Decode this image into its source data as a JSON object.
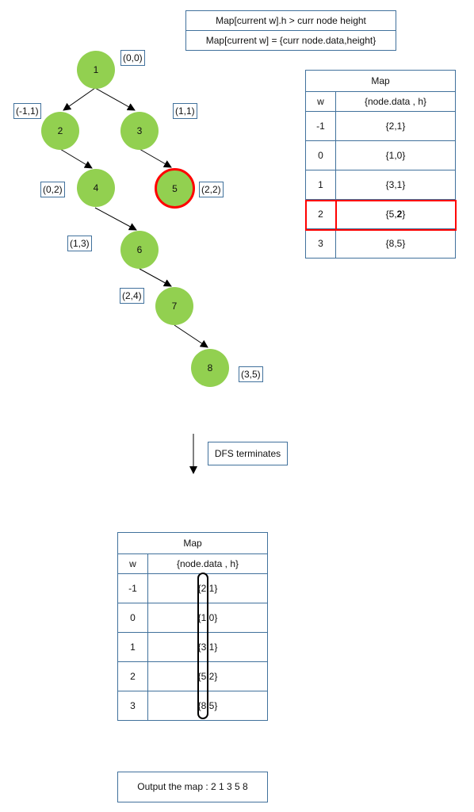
{
  "rules": {
    "condition": "Map[current w].h > curr  node height",
    "action": "Map[current w] = {curr  node.data,height}"
  },
  "tree": {
    "nodes": [
      {
        "id": "1",
        "coord": "(0,0)",
        "highlighted": false
      },
      {
        "id": "2",
        "coord": "(-1,1)",
        "highlighted": false
      },
      {
        "id": "3",
        "coord": "(1,1)",
        "highlighted": false
      },
      {
        "id": "4",
        "coord": "(0,2)",
        "highlighted": false
      },
      {
        "id": "5",
        "coord": "(2,2)",
        "highlighted": true
      },
      {
        "id": "6",
        "coord": "(1,3)",
        "highlighted": false
      },
      {
        "id": "7",
        "coord": "(2,4)",
        "highlighted": false
      },
      {
        "id": "8",
        "coord": "(3,5)",
        "highlighted": false
      }
    ],
    "edges": [
      [
        "1",
        "2"
      ],
      [
        "1",
        "3"
      ],
      [
        "2",
        "4"
      ],
      [
        "3",
        "5"
      ],
      [
        "4",
        "6"
      ],
      [
        "6",
        "7"
      ],
      [
        "7",
        "8"
      ]
    ],
    "node_color": "#92d050",
    "highlight_color": "#ff0000"
  },
  "map_table_top": {
    "title": "Map",
    "col_w": "w",
    "col_val": "{node.data , h}",
    "rows": [
      {
        "w": "-1",
        "val": "{2,1}"
      },
      {
        "w": "0",
        "val": "{1,0}"
      },
      {
        "w": "1",
        "val": "{3,1}"
      },
      {
        "w": "2",
        "val_a": "{5,",
        "val_b": "2",
        "val_c": "}",
        "highlighted": true
      },
      {
        "w": "3",
        "val": "{8,5}"
      }
    ]
  },
  "transition": {
    "label": "DFS terminates"
  },
  "map_table_final": {
    "title": "Map",
    "col_w": "w",
    "col_val": "{node.data , h}",
    "rows": [
      {
        "w": "-1",
        "val": "{2 1}"
      },
      {
        "w": "0",
        "val": "{1 0}"
      },
      {
        "w": "1",
        "val": "{3 1}"
      },
      {
        "w": "2",
        "val": "{5 2}"
      },
      {
        "w": "3",
        "val": "{8 5}"
      }
    ]
  },
  "output": {
    "label": "Output the map : 2 1 3 5 8"
  }
}
